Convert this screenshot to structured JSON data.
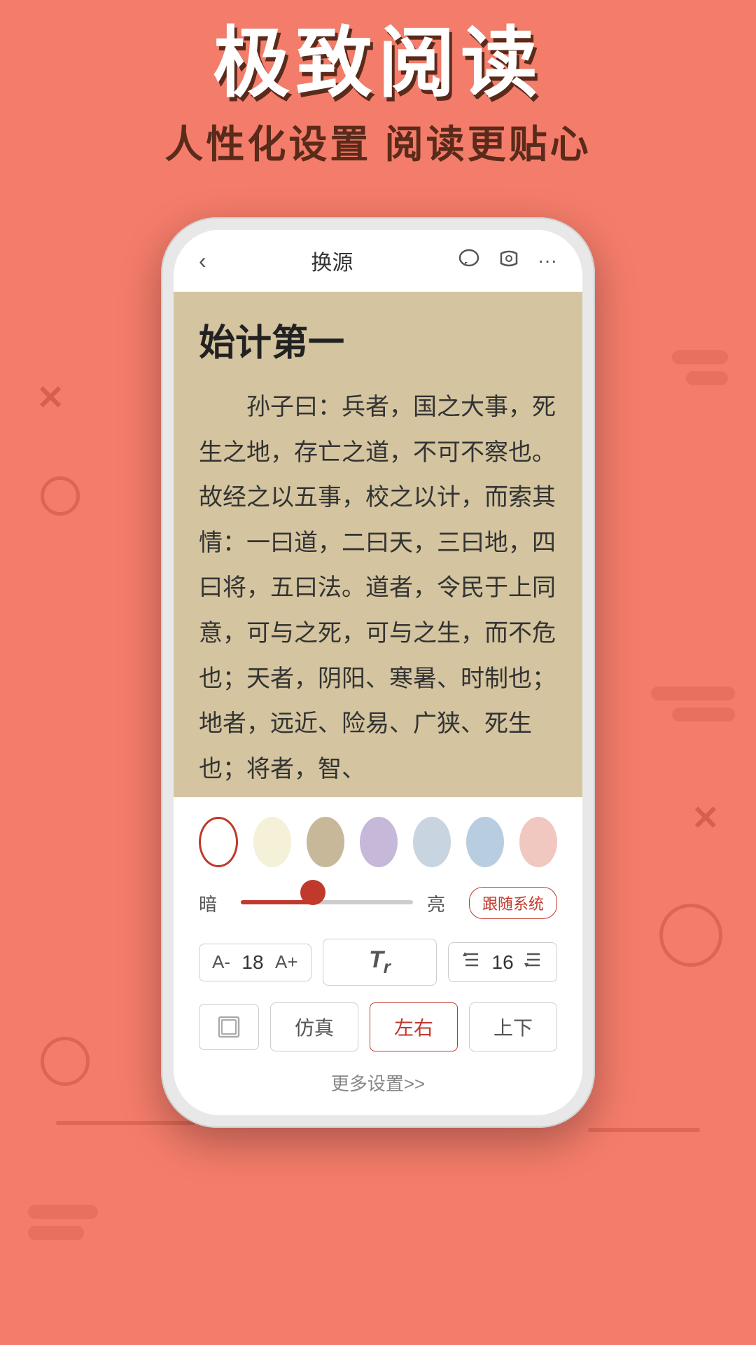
{
  "header": {
    "main_title": "极致阅读",
    "sub_title": "人性化设置  阅读更贴心"
  },
  "nav": {
    "back_icon": "‹",
    "title": "换源",
    "comment_icon": "💬",
    "audio_icon": "🎧",
    "more_icon": "···"
  },
  "reading": {
    "chapter_title": "始计第一",
    "content": "孙子曰：兵者，国之大事，死生之地，存亡之道，不可不察也。故经之以五事，校之以计，而索其情：一曰道，二曰天，三曰地，四曰将，五曰法。道者，令民于上同意，可与之死，可与之生，而不危也；天者，阴阳、寒暑、时制也；地者，远近、险易、广狭、死生也；将者，智、"
  },
  "settings": {
    "colors": [
      {
        "id": "white",
        "hex": "#FFFFFF",
        "selected": true
      },
      {
        "id": "cream",
        "hex": "#F5F0D8",
        "selected": false
      },
      {
        "id": "tan",
        "hex": "#C8B89A",
        "selected": false
      },
      {
        "id": "lavender",
        "hex": "#C5B8D8",
        "selected": false
      },
      {
        "id": "light_blue",
        "hex": "#C8D4E0",
        "selected": false
      },
      {
        "id": "sky",
        "hex": "#B8CDE0",
        "selected": false
      },
      {
        "id": "blush",
        "hex": "#F0C8C0",
        "selected": false
      }
    ],
    "brightness": {
      "dark_label": "暗",
      "light_label": "亮",
      "follow_system_label": "跟随系统",
      "value": 42
    },
    "font": {
      "decrease_label": "A-",
      "size_value": "18",
      "increase_label": "A+",
      "font_icon": "Tr",
      "line_spacing_icon_top": "≑",
      "line_spacing_value": "16",
      "line_spacing_icon_bottom": "≐"
    },
    "mode": {
      "scroll_icon": "⊡",
      "faux_label": "仿真",
      "lr_label": "左右",
      "ud_label": "上下",
      "active": "lr"
    },
    "more_label": "更多设置>>"
  }
}
